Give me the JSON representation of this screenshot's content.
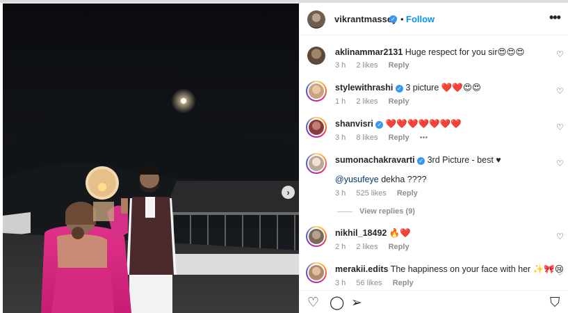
{
  "post": {
    "author": "vikrantmassey",
    "follow_label": "Follow",
    "separator": "•",
    "verified_glyph": "✓",
    "more_glyph": "•••",
    "next_glyph": "›"
  },
  "comments": [
    {
      "user": "aklinammar2131",
      "text": "Huge respect for you sir😍😍😍",
      "time": "3 h",
      "likes": "2 likes",
      "reply": "Reply",
      "verified": false,
      "story_ring": false,
      "avatar_color": "#5b4a3a"
    },
    {
      "user": "stylewithrashi",
      "text": "3 picture ❤️❤️😍😍",
      "time": "1 h",
      "likes": "2 likes",
      "reply": "Reply",
      "verified": true,
      "story_ring": true,
      "avatar_color": "#c9a27e"
    },
    {
      "user": "shanvisri",
      "text": "❤️❤️❤️❤️❤️❤️❤️",
      "time": "3 h",
      "likes": "8 likes",
      "reply": "Reply",
      "extra": "•••",
      "verified": true,
      "story_ring": true,
      "avatar_color": "#8a3b3b"
    },
    {
      "user": "sumonachakravarti",
      "text": "3rd Picture - best ♥",
      "mention": "@yusufeye",
      "text2": "dekha ????",
      "time": "3 h",
      "likes": "525 likes",
      "reply": "Reply",
      "verified": true,
      "story_ring": true,
      "avatar_color": "#d8c8b8"
    },
    {
      "user": "nikhil_18492",
      "text": "🔥❤️",
      "time": "2 h",
      "likes": "2 likes",
      "reply": "Reply",
      "verified": false,
      "story_ring": true,
      "avatar_color": "#7a6a5a"
    },
    {
      "user": "merakii.edits",
      "text": "The happiness on your face with her ✨🎀😢",
      "time": "3 h",
      "likes": "56 likes",
      "reply": "Reply",
      "verified": false,
      "story_ring": true,
      "avatar_color": "#b08a6a"
    }
  ],
  "view_replies": "View replies (9)",
  "icons": {
    "heart": "♡",
    "like": "♡",
    "comment": "◯",
    "share": "➢",
    "save": "⛉"
  }
}
